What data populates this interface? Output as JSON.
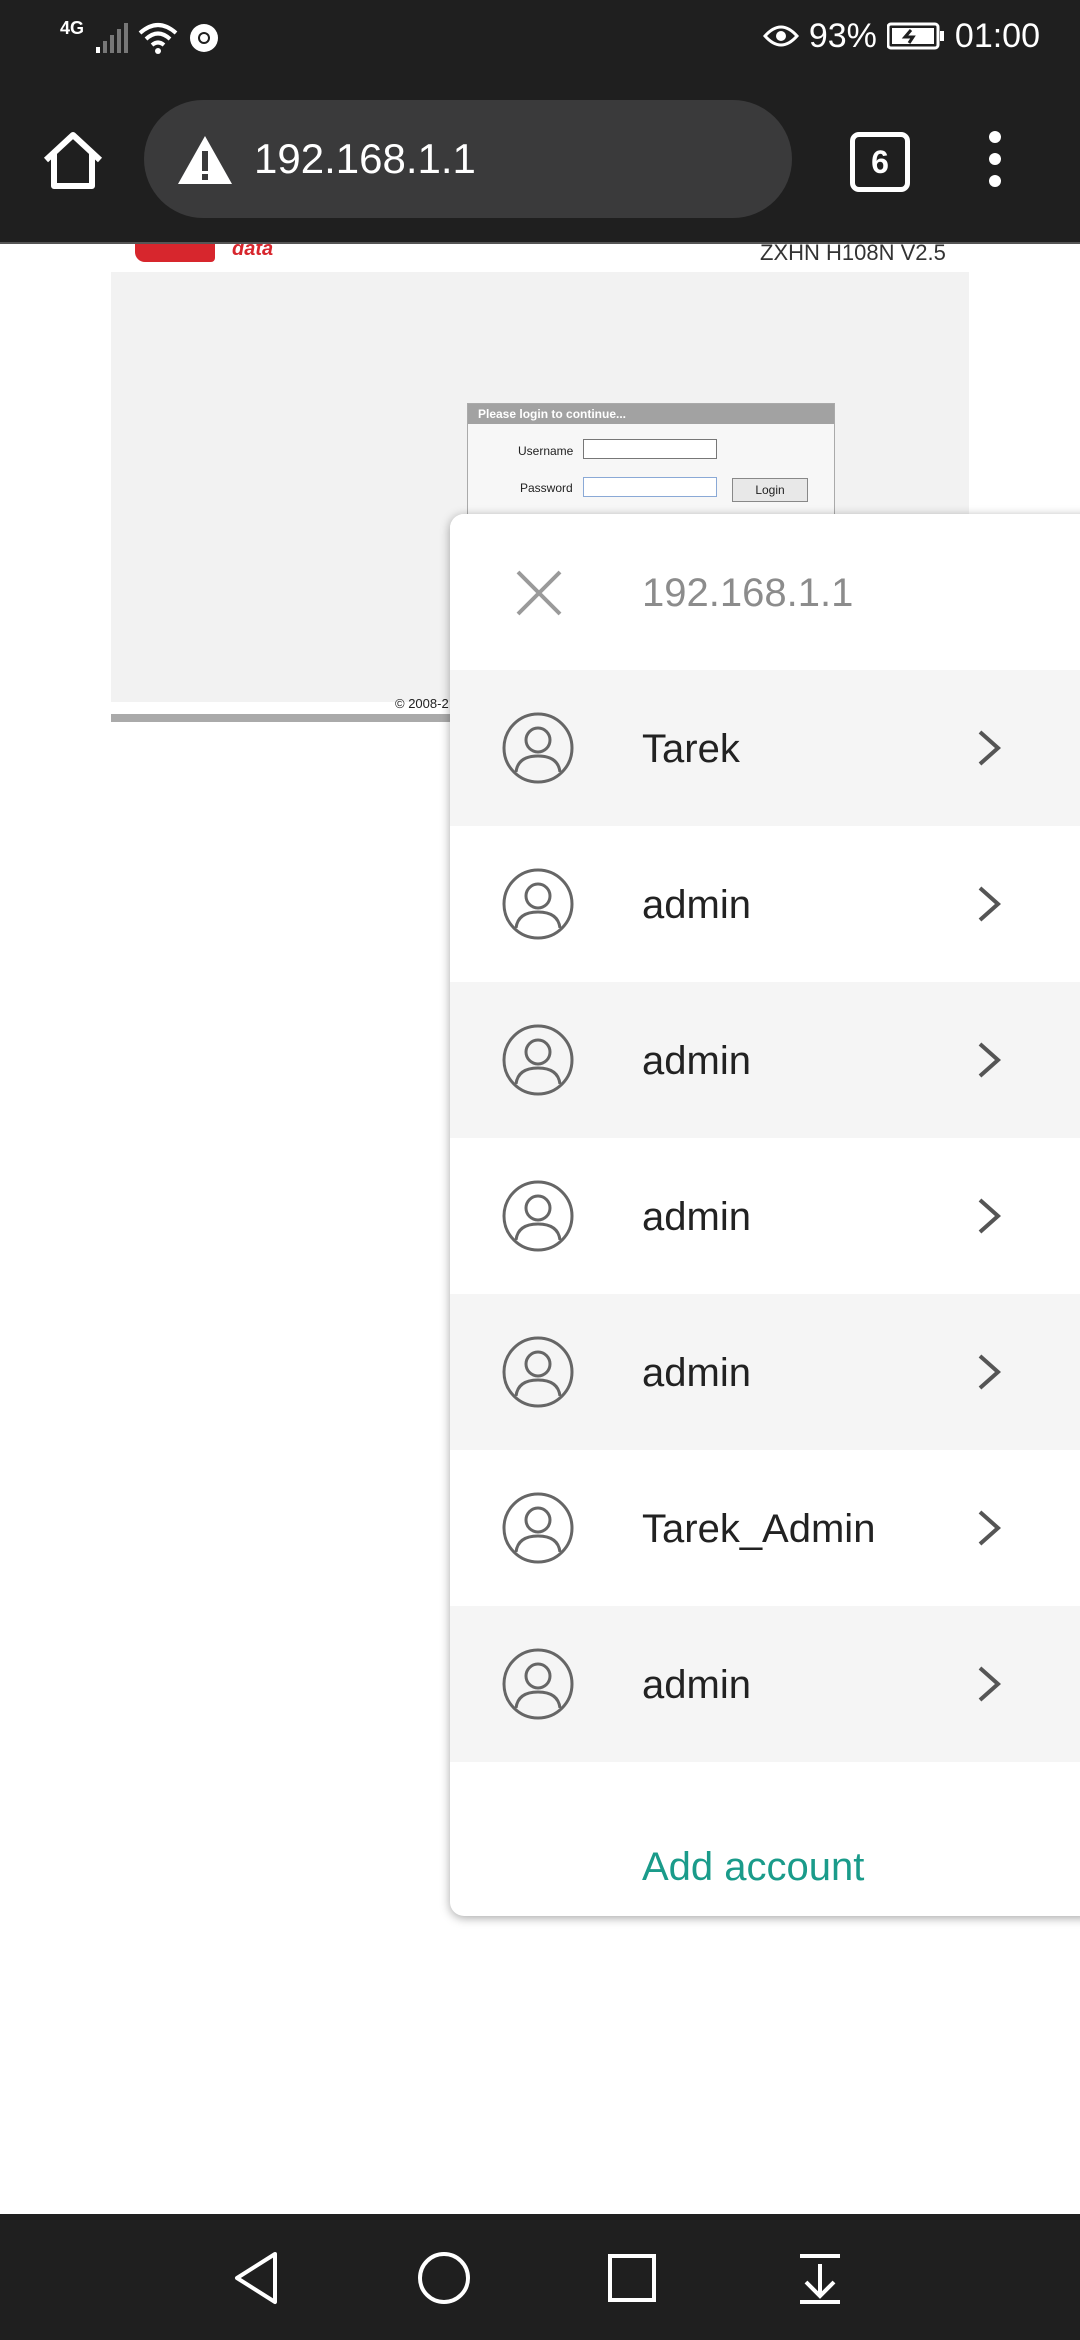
{
  "status_bar": {
    "network": "4G",
    "battery": "93%",
    "time": "01:00"
  },
  "browser": {
    "url": "192.168.1.1",
    "tab_count": "6",
    "icons": [
      "home-icon",
      "warning-icon",
      "tab-switcher-icon",
      "more-menu-icon"
    ]
  },
  "webpage": {
    "logo_sub": "data",
    "model": "ZXHN H108N V2.5",
    "login": {
      "title": "Please login to continue...",
      "username_label": "Username",
      "password_label": "Password",
      "button": "Login"
    },
    "copyright": "© 2008-2"
  },
  "picker": {
    "host": "192.168.1.1",
    "accounts": [
      {
        "name": "Tarek"
      },
      {
        "name": "admin"
      },
      {
        "name": "admin"
      },
      {
        "name": "admin"
      },
      {
        "name": "admin"
      },
      {
        "name": "Tarek_Admin"
      },
      {
        "name": "admin"
      }
    ],
    "add_account": "Add account",
    "accent_color": "#1a9b8a"
  }
}
